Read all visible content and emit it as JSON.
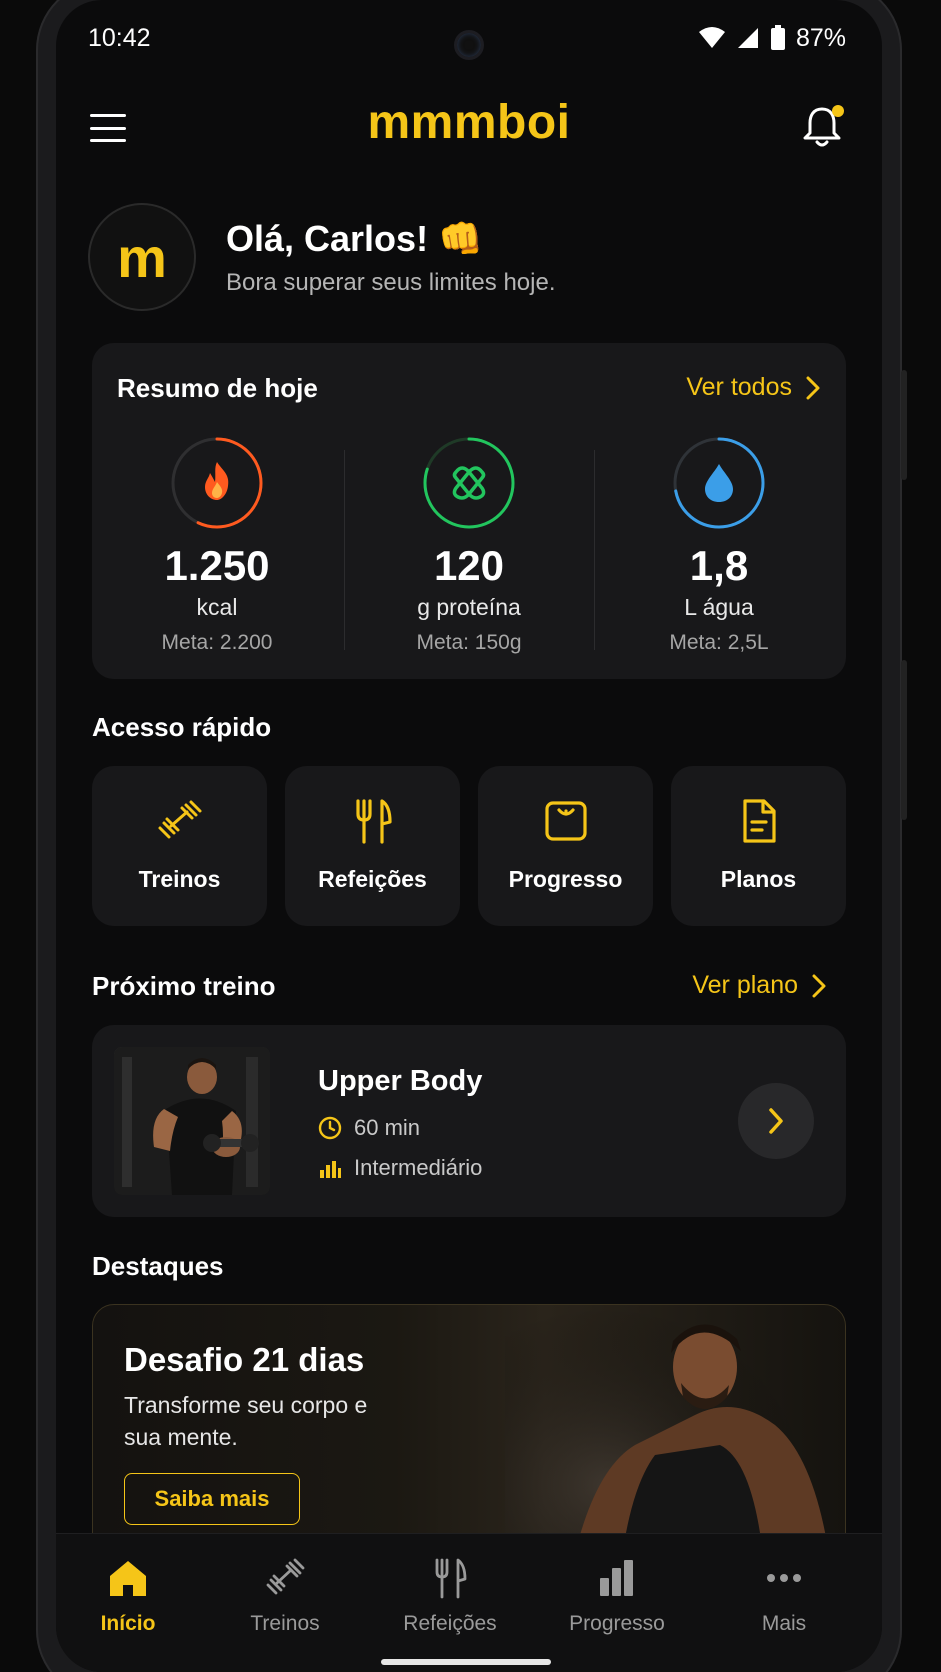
{
  "status": {
    "time": "10:42",
    "battery": "87%"
  },
  "app": {
    "logo": "mmmboi",
    "avatar_letter": "m"
  },
  "greeting": {
    "title": "Olá, Carlos! 👊",
    "subtitle": "Bora superar seus limites hoje."
  },
  "summary": {
    "title": "Resumo de hoje",
    "link": "Ver todos",
    "stats": [
      {
        "value": "1.250",
        "unit": "kcal",
        "goal": "Meta: 2.200",
        "progress": 0.57,
        "color": "#ff5a1f",
        "icon": "flame-icon"
      },
      {
        "value": "120",
        "unit": "g proteína",
        "goal": "Meta: 150g",
        "progress": 0.8,
        "color": "#22c55e",
        "icon": "protein-icon"
      },
      {
        "value": "1,8",
        "unit": "L água",
        "goal": "Meta: 2,5L",
        "progress": 0.72,
        "color": "#3b9ee8",
        "icon": "water-drop-icon"
      }
    ]
  },
  "quick": {
    "title": "Acesso rápido",
    "items": [
      {
        "label": "Treinos",
        "icon": "dumbbell-icon"
      },
      {
        "label": "Refeições",
        "icon": "fork-knife-icon"
      },
      {
        "label": "Progresso",
        "icon": "scale-icon"
      },
      {
        "label": "Planos",
        "icon": "document-icon"
      }
    ]
  },
  "next_workout": {
    "title": "Próximo treino",
    "link": "Ver plano",
    "name": "Upper Body",
    "duration": "60 min",
    "level": "Intermediário"
  },
  "highlights": {
    "title": "Destaques",
    "card_title": "Desafio 21 dias",
    "card_text": "Transforme seu corpo e sua mente.",
    "button": "Saiba mais"
  },
  "nav": [
    {
      "label": "Início",
      "icon": "home-icon",
      "active": true
    },
    {
      "label": "Treinos",
      "icon": "dumbbell-icon"
    },
    {
      "label": "Refeições",
      "icon": "fork-knife-icon"
    },
    {
      "label": "Progresso",
      "icon": "bar-chart-icon"
    },
    {
      "label": "Mais",
      "icon": "more-icon"
    }
  ],
  "colors": {
    "accent": "#f5c518",
    "background": "#0b0b0c",
    "card": "#18181a"
  }
}
